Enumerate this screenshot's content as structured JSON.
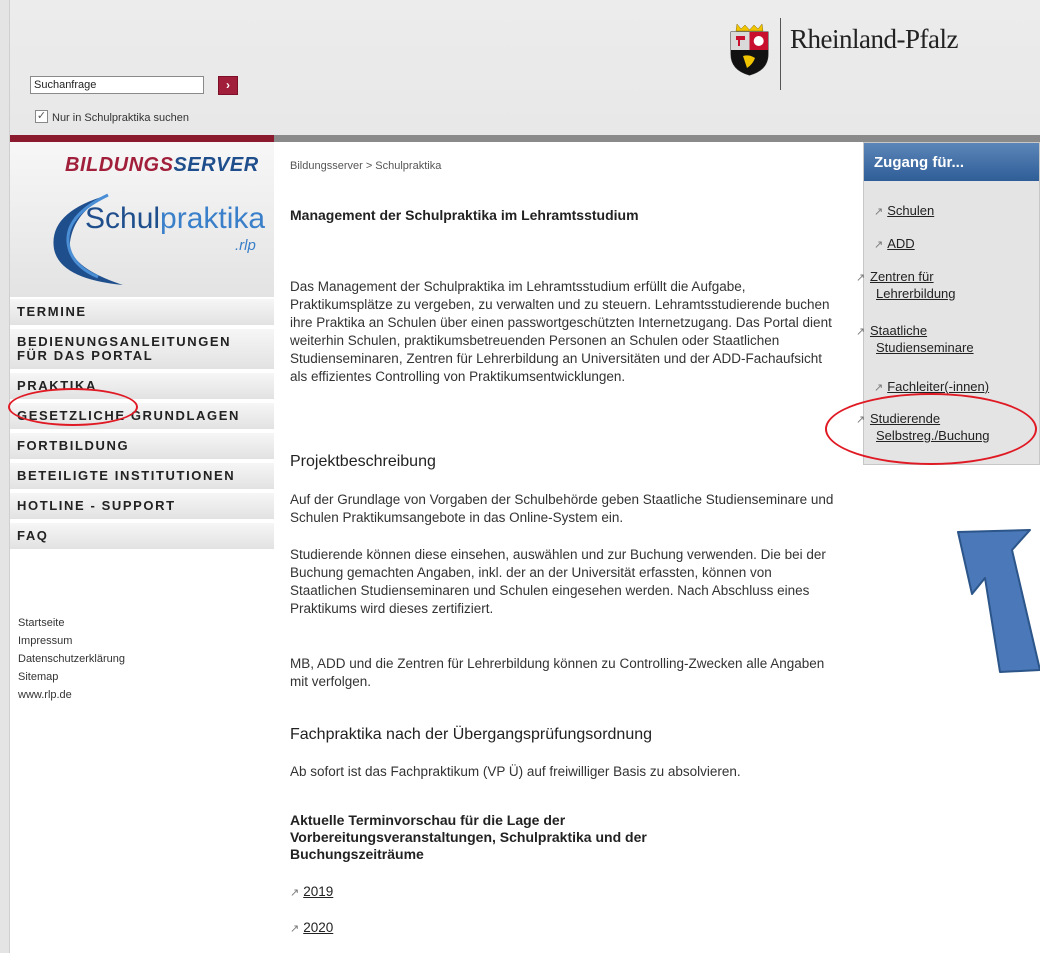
{
  "header": {
    "search_value": "Suchanfrage",
    "search_button": "›",
    "checkbox_label": "Nur in Schulpraktika suchen",
    "checkbox_checked": true,
    "state_logo_text": "Rheinland-Pfalz"
  },
  "sidebar": {
    "brand": {
      "title_part1": "BILDUNGS",
      "title_part2": "SERVER",
      "name_part1": "Schul",
      "name_part2": "praktika",
      "suffix": ".rlp"
    },
    "nav": [
      {
        "label": "TERMINE"
      },
      {
        "label": "BEDIENUNGSANLEITUNGEN FÜR DAS PORTAL"
      },
      {
        "label": "PRAKTIKA"
      },
      {
        "label": "GESETZLICHE GRUNDLAGEN"
      },
      {
        "label": "FORTBILDUNG"
      },
      {
        "label": "BETEILIGTE INSTITUTIONEN"
      },
      {
        "label": "HOTLINE - SUPPORT"
      },
      {
        "label": "FAQ"
      }
    ],
    "footer_links": [
      {
        "label": "Startseite"
      },
      {
        "label": "Impressum"
      },
      {
        "label": "Datenschutzerklärung"
      },
      {
        "label": "Sitemap"
      },
      {
        "label": "www.rlp.de"
      }
    ]
  },
  "main": {
    "breadcrumb": "Bildungsserver > Schulpraktika",
    "title": "Management der Schulpraktika im Lehramtsstudium",
    "intro": "Das Management der Schulpraktika im Lehramtsstudium erfüllt die Aufgabe, Praktikumsplätze zu vergeben, zu verwalten und zu steuern. Lehramtsstudierende buchen ihre Praktika an Schulen über einen passwortgeschützten Internetzugang. Das Portal dient weiterhin Schulen, praktikumsbetreuenden Personen an Schulen oder Staatlichen Studienseminaren, Zentren für Lehrerbildung an Universitäten und der ADD-Fachaufsicht als effizientes Controlling von Praktikumsentwicklungen.",
    "section1_heading": "Projektbeschreibung",
    "section1_p1": "Auf der Grundlage von Vorgaben der Schulbehörde geben Staatliche Studienseminare und Schulen Praktikumsangebote in das Online-System ein.",
    "section1_p2": "Studierende können diese einsehen, auswählen und zur Buchung verwenden. Die bei der Buchung gemachten Angaben, inkl. der an der Universität erfassten, können von Staatlichen Studienseminaren und Schulen eingesehen werden. Nach Abschluss eines Praktikums wird dieses zertifiziert.",
    "section1_p3": "MB, ADD und die Zentren für Lehrerbildung können zu Controlling-Zwecken alle Angaben mit verfolgen.",
    "section2_heading": "Fachpraktika nach der Übergangsprüfungsordnung",
    "section2_p1": "Ab sofort ist das Fachpraktikum (VP Ü) auf freiwilliger Basis zu absolvieren.",
    "section3_heading": "Aktuelle Terminvorschau für die Lage der Vorbereitungsveranstaltungen, Schulpraktika und der Buchungszeiträume",
    "year_links": [
      {
        "label": "2019"
      },
      {
        "label": "2020"
      }
    ]
  },
  "panel": {
    "heading": "Zugang für...",
    "links": [
      {
        "label": "Schulen"
      },
      {
        "label": "ADD"
      },
      {
        "label": "Zentren für Lehrerbildung"
      },
      {
        "label": "Staatliche Studienseminare"
      },
      {
        "label": "Fachleiter(-innen)"
      },
      {
        "label": "Studierende Selbstreg./Buchung"
      }
    ]
  },
  "colors": {
    "accent_red": "#a11f3b",
    "panel_blue": "#2f5d97",
    "annotation_red": "#e01a24",
    "annotation_arrow": "#4a78b8"
  }
}
